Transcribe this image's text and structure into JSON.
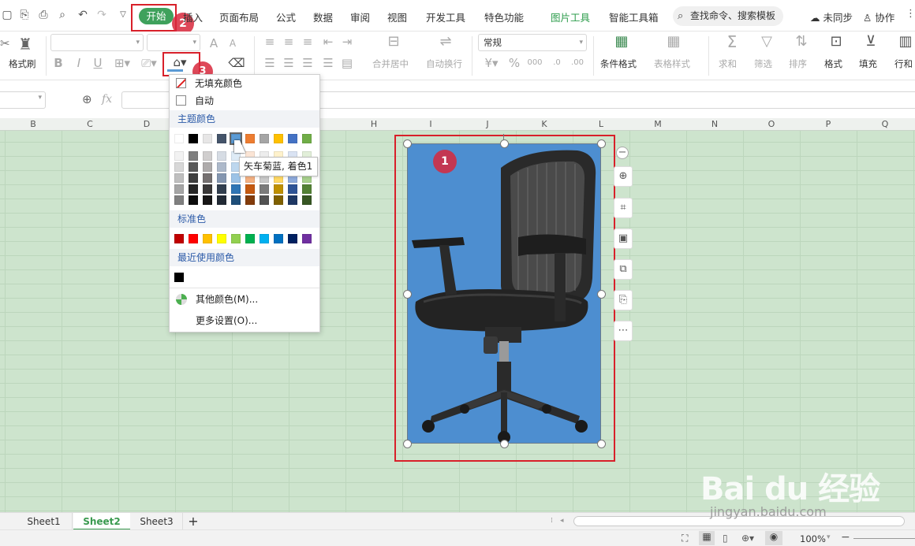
{
  "menubar": {
    "tabs": [
      "开始",
      "插入",
      "页面布局",
      "公式",
      "数据",
      "审阅",
      "视图",
      "开发工具",
      "特色功能",
      "图片工具",
      "智能工具箱"
    ],
    "search_placeholder": "查找命令、搜索模板",
    "sync_label": "未同步",
    "collab_label": "协作"
  },
  "ribbon": {
    "format_painter": "格式刷",
    "number_format": "常规",
    "merge_center": "合并居中",
    "auto_wrap": "自动换行",
    "conditional_format": "条件格式",
    "table_style": "表格样式",
    "sum": "求和",
    "filter": "筛选",
    "sort": "排序",
    "format": "格式",
    "fill": "填充",
    "rows_cols": "行和"
  },
  "formula": {
    "fx": "fx"
  },
  "columns": [
    "B",
    "C",
    "D",
    "H",
    "I",
    "J",
    "K",
    "L",
    "M",
    "N",
    "O",
    "P",
    "Q"
  ],
  "dropdown": {
    "no_fill": "无填充颜色",
    "auto": "自动",
    "theme_colors": "主题颜色",
    "standard_colors": "标准色",
    "recent_colors": "最近使用颜色",
    "more_colors": "其他颜色(M)...",
    "more_settings": "更多设置(O)...",
    "tooltip": "矢车菊蓝, 着色1",
    "theme_top": [
      "#ffffff",
      "#000000",
      "#e7e6e6",
      "#44546a",
      "#5b9bd5",
      "#ed7d31",
      "#a5a5a5",
      "#ffc000",
      "#4472c4",
      "#70ad47"
    ],
    "theme_shades": [
      [
        "#f2f2f2",
        "#7f7f7f",
        "#d0cece",
        "#d6dce4",
        "#deebf6",
        "#fbe5d5",
        "#ededed",
        "#fff2cc",
        "#dae3f3",
        "#e2efd9"
      ],
      [
        "#d8d8d8",
        "#595959",
        "#aeabab",
        "#adb9ca",
        "#bdd7ee",
        "#f7cbac",
        "#dbdbdb",
        "#fee599",
        "#b4c6e7",
        "#c5e0b3"
      ],
      [
        "#bfbfbf",
        "#3f3f3f",
        "#757070",
        "#8496b0",
        "#9dc3e6",
        "#f4b183",
        "#c9c9c9",
        "#ffd965",
        "#8eaadb",
        "#a8d08d"
      ],
      [
        "#a5a5a5",
        "#262626",
        "#3a3838",
        "#323f4f",
        "#2e75b5",
        "#c55a11",
        "#7b7b7b",
        "#bf9000",
        "#2f5496",
        "#538135"
      ],
      [
        "#7f7f7f",
        "#0c0c0c",
        "#171616",
        "#222a35",
        "#1e4e79",
        "#833c0b",
        "#525252",
        "#7f6000",
        "#1f3864",
        "#375623"
      ]
    ],
    "standard": [
      "#c00000",
      "#ff0000",
      "#ffc000",
      "#ffff00",
      "#92d050",
      "#00b050",
      "#00b0f0",
      "#0070c0",
      "#002060",
      "#7030a0"
    ],
    "recent": [
      "#000000"
    ]
  },
  "badges": {
    "one": "1",
    "two": "2",
    "three": "3"
  },
  "sheets": [
    "Sheet1",
    "Sheet2",
    "Sheet3"
  ],
  "status": {
    "zoom": "100%"
  },
  "watermark": {
    "text": "Bai du 经验",
    "url": "jingyan.baidu.com"
  }
}
